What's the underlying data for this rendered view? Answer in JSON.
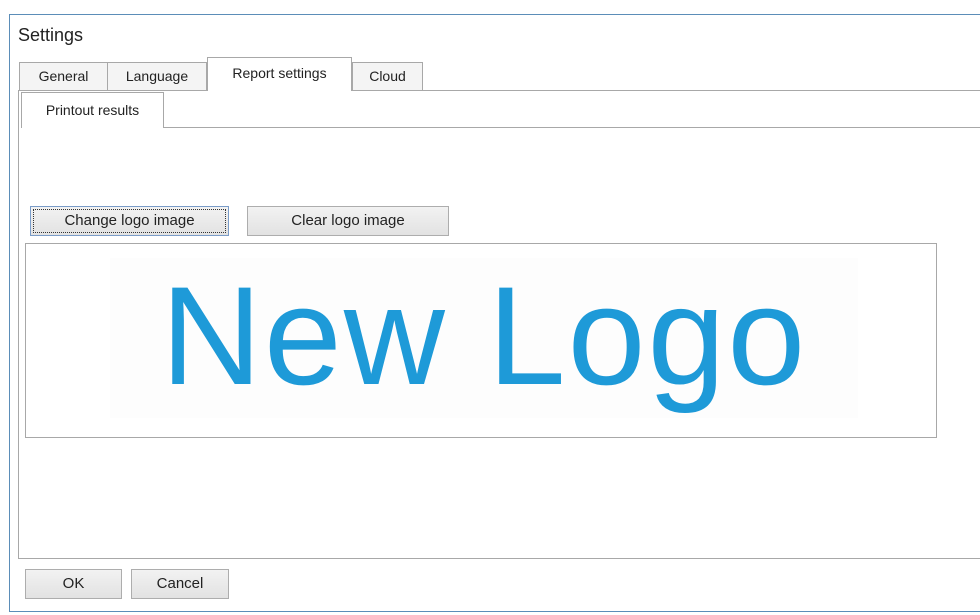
{
  "window": {
    "title": "Settings"
  },
  "tabs": [
    {
      "label": "General"
    },
    {
      "label": "Language"
    },
    {
      "label": "Report settings",
      "selected": true
    },
    {
      "label": "Cloud"
    }
  ],
  "subtabs": [
    {
      "label": "Printout results",
      "selected": true
    }
  ],
  "logo_section": {
    "change_label": "Change logo image",
    "clear_label": "Clear logo image",
    "logo_text": "New Logo",
    "logo_color": "#1e9ad8"
  },
  "footer": {
    "ok_label": "OK",
    "cancel_label": "Cancel"
  }
}
